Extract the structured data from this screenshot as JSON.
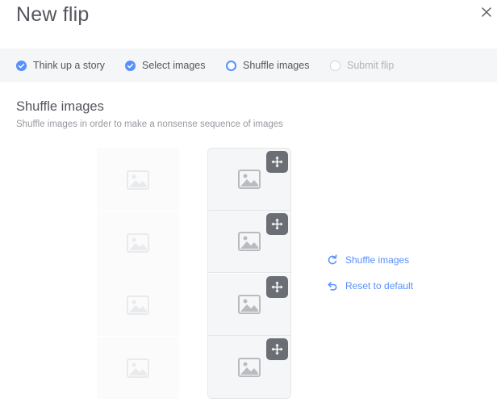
{
  "header": {
    "title": "New flip"
  },
  "stepper": {
    "steps": [
      {
        "label": "Think up a story",
        "state": "done"
      },
      {
        "label": "Select images",
        "state": "done"
      },
      {
        "label": "Shuffle images",
        "state": "active"
      },
      {
        "label": "Submit flip",
        "state": "pending"
      }
    ]
  },
  "section": {
    "title": "Shuffle images",
    "subtitle": "Shuffle images in order to make a nonsense sequence of images"
  },
  "actions": {
    "shuffle_label": "Shuffle images",
    "reset_label": "Reset to default"
  },
  "icons": {
    "close": "close-icon",
    "step_done": "check-circle-icon",
    "image_placeholder": "image-placeholder-icon",
    "move": "move-arrows-icon",
    "shuffle": "refresh-icon",
    "reset": "undo-icon"
  },
  "colors": {
    "accent": "#578fff",
    "text": "#53565c",
    "muted": "#96999e",
    "pending": "#b1b3b8",
    "stepper_bg": "#f5f6f7",
    "move_button": "#6b6e74"
  }
}
